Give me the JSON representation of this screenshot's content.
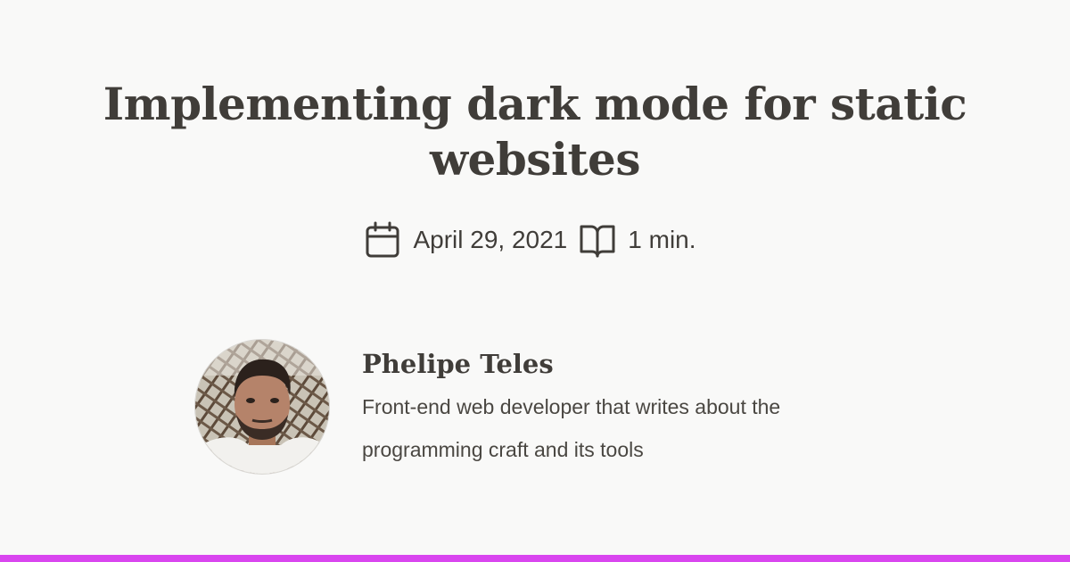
{
  "post": {
    "title": "Implementing dark mode for static websites",
    "date": "April 29, 2021",
    "reading_time": "1 min."
  },
  "icons": {
    "date": "calendar-icon",
    "reading_time": "open-book-icon"
  },
  "author": {
    "name": "Phelipe Teles",
    "bio": "Front-end web developer that writes about the programming craft and its tools"
  },
  "colors": {
    "background": "#f9f9f8",
    "text": "#403d39",
    "accent_bar": "#d946ef"
  }
}
